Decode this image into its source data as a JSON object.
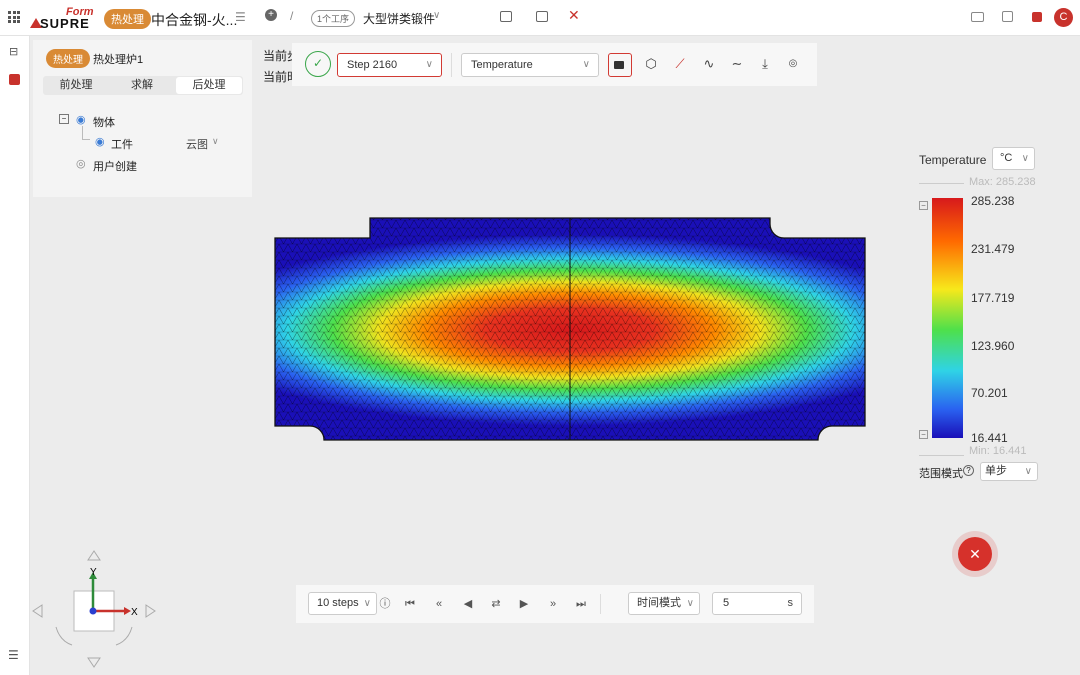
{
  "topbar": {
    "logo_text": "SUPRE",
    "logo_script": "Form",
    "module_badge": "热处理",
    "project_title": "中合金钢-火...",
    "step_count_pill": "1个工序",
    "process_name": "大型饼类锻件",
    "avatar_letter": "C"
  },
  "panel": {
    "badge": "热处理",
    "furnace": "热处理炉1",
    "tabs": [
      "前处理",
      "求解",
      "后处理"
    ],
    "tree": {
      "root": "物体",
      "child": "工件",
      "child_mode": "云图",
      "user_created": "用户创建"
    }
  },
  "info": {
    "line1": "当前步",
    "line2": "当前时"
  },
  "toolbar": {
    "step_select": "Step 2160",
    "variable_select": "Temperature"
  },
  "legend": {
    "title": "Temperature",
    "unit": "°C",
    "max_label": "Max: 285.238",
    "min_label": "Min: 16.441",
    "ticks": [
      "285.238",
      "231.479",
      "177.719",
      "123.960",
      "70.201",
      "16.441"
    ],
    "range_mode_label": "范围模式",
    "range_mode_value": "单步",
    "colors": [
      "#d7191c",
      "#ff6a00",
      "#f7e81b",
      "#4ee04b",
      "#2fd3e6",
      "#2a62f0",
      "#1a0fb8"
    ]
  },
  "playbar": {
    "steps_select": "10 steps",
    "time_mode": "时间模式",
    "time_value": "5",
    "time_unit": "s"
  },
  "axes": {
    "x_label": "X",
    "y_label": "Y"
  }
}
